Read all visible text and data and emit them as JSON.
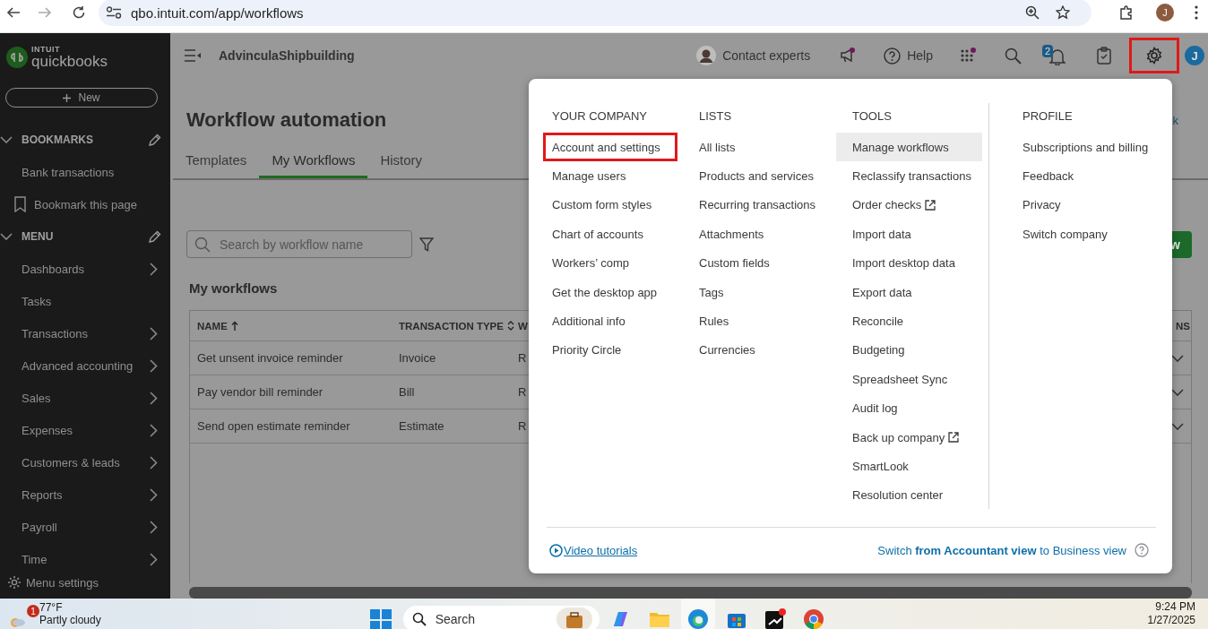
{
  "browser": {
    "url": "qbo.intuit.com/app/workflows",
    "profile_initial": "J"
  },
  "sidebar": {
    "logo_brand": "INTUIT",
    "logo_product": "quickbooks",
    "new_button": "New",
    "sections": [
      {
        "title": "BOOKMARKS",
        "expanded": true,
        "items": [
          {
            "label": "Bank transactions",
            "kind": "link"
          },
          {
            "label": "Bookmark this page",
            "kind": "bookmark"
          }
        ]
      },
      {
        "title": "MENU",
        "expanded": true,
        "items": [
          {
            "label": "Dashboards",
            "kind": "submenu"
          },
          {
            "label": "Tasks",
            "kind": "link"
          },
          {
            "label": "Transactions",
            "kind": "submenu"
          },
          {
            "label": "Advanced accounting",
            "kind": "submenu"
          },
          {
            "label": "Sales",
            "kind": "submenu"
          },
          {
            "label": "Expenses",
            "kind": "submenu"
          },
          {
            "label": "Customers & leads",
            "kind": "submenu"
          },
          {
            "label": "Reports",
            "kind": "submenu"
          },
          {
            "label": "Payroll",
            "kind": "submenu"
          },
          {
            "label": "Time",
            "kind": "submenu"
          }
        ]
      }
    ],
    "menu_settings": "Menu settings"
  },
  "header": {
    "company": "AdvinculaShipbuilding",
    "contact": "Contact experts",
    "help": "Help",
    "notification_count": "2",
    "avatar_initial": "J",
    "settings_outlined": true
  },
  "page": {
    "title": "Workflow automation",
    "link_partial": "k",
    "tabs": [
      {
        "label": "Templates",
        "selected": false
      },
      {
        "label": "My Workflows",
        "selected": true
      },
      {
        "label": "History",
        "selected": false
      }
    ],
    "search_placeholder": "Search by workflow name",
    "button_partial": "w",
    "section_title": "My workflows",
    "table": {
      "columns": [
        {
          "label": "NAME",
          "kind": "ascending"
        },
        {
          "label": "TRANSACTION TYPE",
          "kind": "sortable"
        },
        {
          "label": "W",
          "kind": "plain"
        },
        {
          "label": "NS",
          "kind": "plain"
        }
      ],
      "rows": [
        {
          "name": "Get unsent invoice reminder",
          "type": "Invoice",
          "column_3": "R"
        },
        {
          "name": "Pay vendor bill reminder",
          "type": "Bill",
          "column_3": "R"
        },
        {
          "name": "Send open estimate reminder",
          "type": "Estimate",
          "column_3": "R"
        }
      ]
    }
  },
  "settings_menu": {
    "columns": [
      {
        "title": "YOUR COMPANY",
        "items": [
          {
            "label": "Account and settings",
            "selected": false,
            "outlined": true,
            "external": false
          },
          {
            "label": "Manage users",
            "selected": false,
            "outlined": false,
            "external": false
          },
          {
            "label": "Custom form styles",
            "selected": false,
            "outlined": false,
            "external": false
          },
          {
            "label": "Chart of accounts",
            "selected": false,
            "outlined": false,
            "external": false
          },
          {
            "label": "Workers’ comp",
            "selected": false,
            "outlined": false,
            "external": false
          },
          {
            "label": "Get the desktop app",
            "selected": false,
            "outlined": false,
            "external": false
          },
          {
            "label": "Additional info",
            "selected": false,
            "outlined": false,
            "external": false
          },
          {
            "label": "Priority Circle",
            "selected": false,
            "outlined": false,
            "external": false
          }
        ]
      },
      {
        "title": "LISTS",
        "items": [
          {
            "label": "All lists",
            "selected": false,
            "outlined": false,
            "external": false
          },
          {
            "label": "Products and services",
            "selected": false,
            "outlined": false,
            "external": false
          },
          {
            "label": "Recurring transactions",
            "selected": false,
            "outlined": false,
            "external": false
          },
          {
            "label": "Attachments",
            "selected": false,
            "outlined": false,
            "external": false
          },
          {
            "label": "Custom fields",
            "selected": false,
            "outlined": false,
            "external": false
          },
          {
            "label": "Tags",
            "selected": false,
            "outlined": false,
            "external": false
          },
          {
            "label": "Rules",
            "selected": false,
            "outlined": false,
            "external": false
          },
          {
            "label": "Currencies",
            "selected": false,
            "outlined": false,
            "external": false
          }
        ]
      },
      {
        "title": "TOOLS",
        "items": [
          {
            "label": "Manage workflows",
            "selected": true,
            "outlined": false,
            "external": false
          },
          {
            "label": "Reclassify transactions",
            "selected": false,
            "outlined": false,
            "external": false
          },
          {
            "label": "Order checks",
            "selected": false,
            "outlined": false,
            "external": true
          },
          {
            "label": "Import data",
            "selected": false,
            "outlined": false,
            "external": false
          },
          {
            "label": "Import desktop data",
            "selected": false,
            "outlined": false,
            "external": false
          },
          {
            "label": "Export data",
            "selected": false,
            "outlined": false,
            "external": false
          },
          {
            "label": "Reconcile",
            "selected": false,
            "outlined": false,
            "external": false
          },
          {
            "label": "Budgeting",
            "selected": false,
            "outlined": false,
            "external": false
          },
          {
            "label": "Spreadsheet Sync",
            "selected": false,
            "outlined": false,
            "external": false
          },
          {
            "label": "Audit log",
            "selected": false,
            "outlined": false,
            "external": false
          },
          {
            "label": "Back up company",
            "selected": false,
            "outlined": false,
            "external": true
          },
          {
            "label": "SmartLook",
            "selected": false,
            "outlined": false,
            "external": false
          },
          {
            "label": "Resolution center",
            "selected": false,
            "outlined": false,
            "external": false
          }
        ]
      },
      {
        "title": "PROFILE",
        "items": [
          {
            "label": "Subscriptions and billing",
            "selected": false,
            "outlined": false,
            "external": false
          },
          {
            "label": "Feedback",
            "selected": false,
            "outlined": false,
            "external": false
          },
          {
            "label": "Privacy",
            "selected": false,
            "outlined": false,
            "external": false
          },
          {
            "label": "Switch company",
            "selected": false,
            "outlined": false,
            "external": false
          }
        ]
      }
    ],
    "video_link": "Video tutorials",
    "switch_text": "Switch **from Accountant view** to Business view"
  },
  "taskbar": {
    "weather_badge": "1",
    "temperature": "77°F",
    "condition": "Partly cloudy",
    "search": "Search",
    "time": "9:24 PM",
    "date": "1/27/2025"
  }
}
